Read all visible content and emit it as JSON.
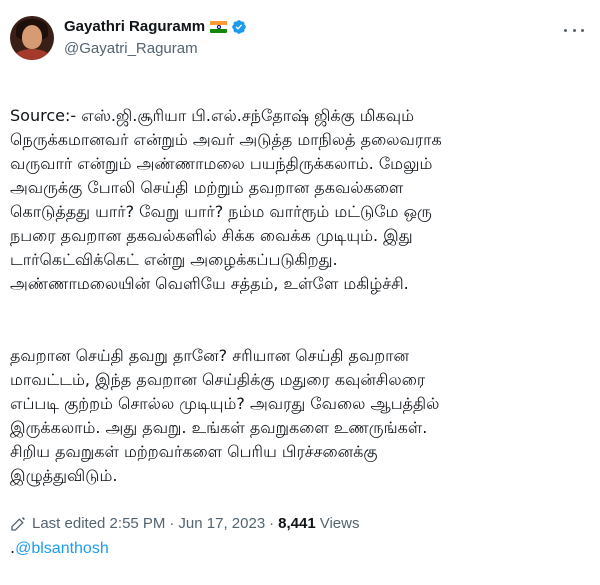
{
  "author": {
    "display_name": "Gayathri Ragurамm",
    "handle": "@Gayatri_Raguram",
    "flag_icon": "india-flag-icon",
    "verified_icon": "verified-badge-icon",
    "verified_color": "#1d9bf0"
  },
  "tweet": {
    "paragraph_1": "Source:- எஸ்.ஜி.சூரியா பி.எல்.சந்தோஷ் ஜிக்கு மிகவும்\nநெருக்கமானவர் என்றும் அவர் அடுத்த மாநிலத் தலைவராக\nவருவார் என்றும் அண்ணாமலை பயந்திருக்கலாம். மேலும்\nஅவருக்கு போலி செய்தி மற்றும் தவறான தகவல்களை\nகொடுத்தது யார்? வேறு யார்? நம்ம வார்ரூம் மட்டுமே ஒரு\nநபரை தவறான தகவல்களில் சிக்க வைக்க முடியும். இது\nடார்கெட்விக்கெட் என்று அழைக்கப்படுகிறது.\nஅண்ணாமலையின் வெளியே சத்தம், உள்ளே மகிழ்ச்சி.",
    "paragraph_2": "தவறான செய்தி தவறு தானே? சரியான செய்தி தவறான\nமாவட்டம், இந்த தவறான செய்திக்கு மதுரை கவுன்சிலரை\nஎப்படி குற்றம் சொல்ல முடியும்? அவரது வேலை ஆபத்தில்\nஇருக்கலாம். அது தவறு. உங்கள் தவறுகளை உணருங்கள்.\nசிறிய தவறுகள் மற்றவர்களை பெரிய பிரச்சனைக்கு\nஇழுத்துவிடும்.",
    "mention_prefix": ".",
    "mention": "@blsanthosh"
  },
  "meta": {
    "edited_label": "Last edited 2:55 PM",
    "separator": "·",
    "date": "Jun 17, 2023",
    "views_count": "8,441",
    "views_label": "Views"
  },
  "colors": {
    "link": "#1d9bf0",
    "secondary_text": "#536471",
    "primary_text": "#0f1419"
  }
}
